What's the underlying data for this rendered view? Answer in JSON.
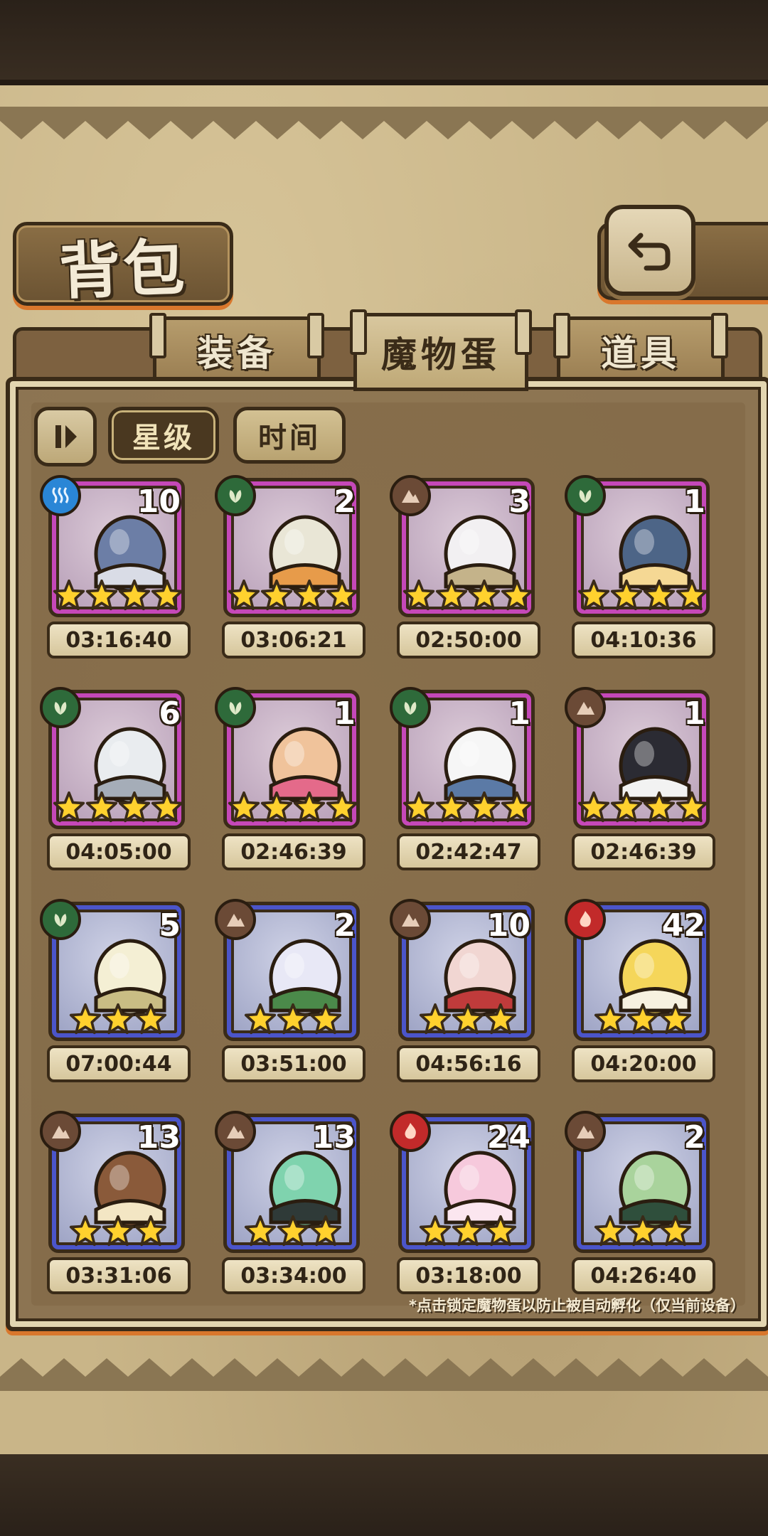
{
  "header": {
    "title": "背包"
  },
  "tabs": [
    {
      "label": "装备",
      "active": false
    },
    {
      "label": "魔物蛋",
      "active": true
    },
    {
      "label": "道具",
      "active": false
    }
  ],
  "sort": {
    "star_label": "星级",
    "time_label": "时间",
    "selected": "星级"
  },
  "eggs": [
    {
      "element": "water",
      "count": "10",
      "stars": 4,
      "frame": "pink",
      "timer": "03:16:40",
      "creature": "battleship"
    },
    {
      "element": "nature",
      "count": "2",
      "stars": 4,
      "frame": "pink",
      "timer": "03:06:21",
      "creature": "feather-egg"
    },
    {
      "element": "earth",
      "count": "3",
      "stars": 4,
      "frame": "pink",
      "timer": "02:50:00",
      "creature": "nest-egg"
    },
    {
      "element": "nature",
      "count": "1",
      "stars": 4,
      "frame": "pink",
      "timer": "04:10:36",
      "creature": "leaf-shell"
    },
    {
      "element": "nature",
      "count": "6",
      "stars": 4,
      "frame": "pink",
      "timer": "04:05:00",
      "creature": "turret-ship"
    },
    {
      "element": "nature",
      "count": "1",
      "stars": 4,
      "frame": "pink",
      "timer": "02:46:39",
      "creature": "painted-egg"
    },
    {
      "element": "nature",
      "count": "1",
      "stars": 4,
      "frame": "pink",
      "timer": "02:42:47",
      "creature": "winged-egg"
    },
    {
      "element": "earth",
      "count": "1",
      "stars": 4,
      "frame": "pink",
      "timer": "02:46:39",
      "creature": "spider-egg"
    },
    {
      "element": "nature",
      "count": "5",
      "stars": 3,
      "frame": "blue",
      "timer": "07:00:44",
      "creature": "lotus-egg"
    },
    {
      "element": "earth",
      "count": "2",
      "stars": 3,
      "frame": "blue",
      "timer": "03:51:00",
      "creature": "flower-egg"
    },
    {
      "element": "earth",
      "count": "10",
      "stars": 3,
      "frame": "blue",
      "timer": "04:56:16",
      "creature": "bow-egg"
    },
    {
      "element": "fire",
      "count": "42",
      "stars": 3,
      "frame": "blue",
      "timer": "04:20:00",
      "creature": "sun-egg"
    },
    {
      "element": "earth",
      "count": "13",
      "stars": 3,
      "frame": "blue",
      "timer": "03:31:06",
      "creature": "bear-basket"
    },
    {
      "element": "earth",
      "count": "13",
      "stars": 3,
      "frame": "blue",
      "timer": "03:34:00",
      "creature": "slime-egg"
    },
    {
      "element": "fire",
      "count": "24",
      "stars": 3,
      "frame": "blue",
      "timer": "03:18:00",
      "creature": "pink-jelly"
    },
    {
      "element": "earth",
      "count": "2",
      "stars": 3,
      "frame": "blue",
      "timer": "04:26:40",
      "creature": "green-beast"
    }
  ],
  "footnote": "*点击锁定魔物蛋以防止被自动孵化（仅当前设备）",
  "colors": {
    "pink_frame": "#c548b8",
    "blue_frame": "#4b55c9",
    "accent": "#d9772c",
    "outline": "#3a2b18"
  }
}
